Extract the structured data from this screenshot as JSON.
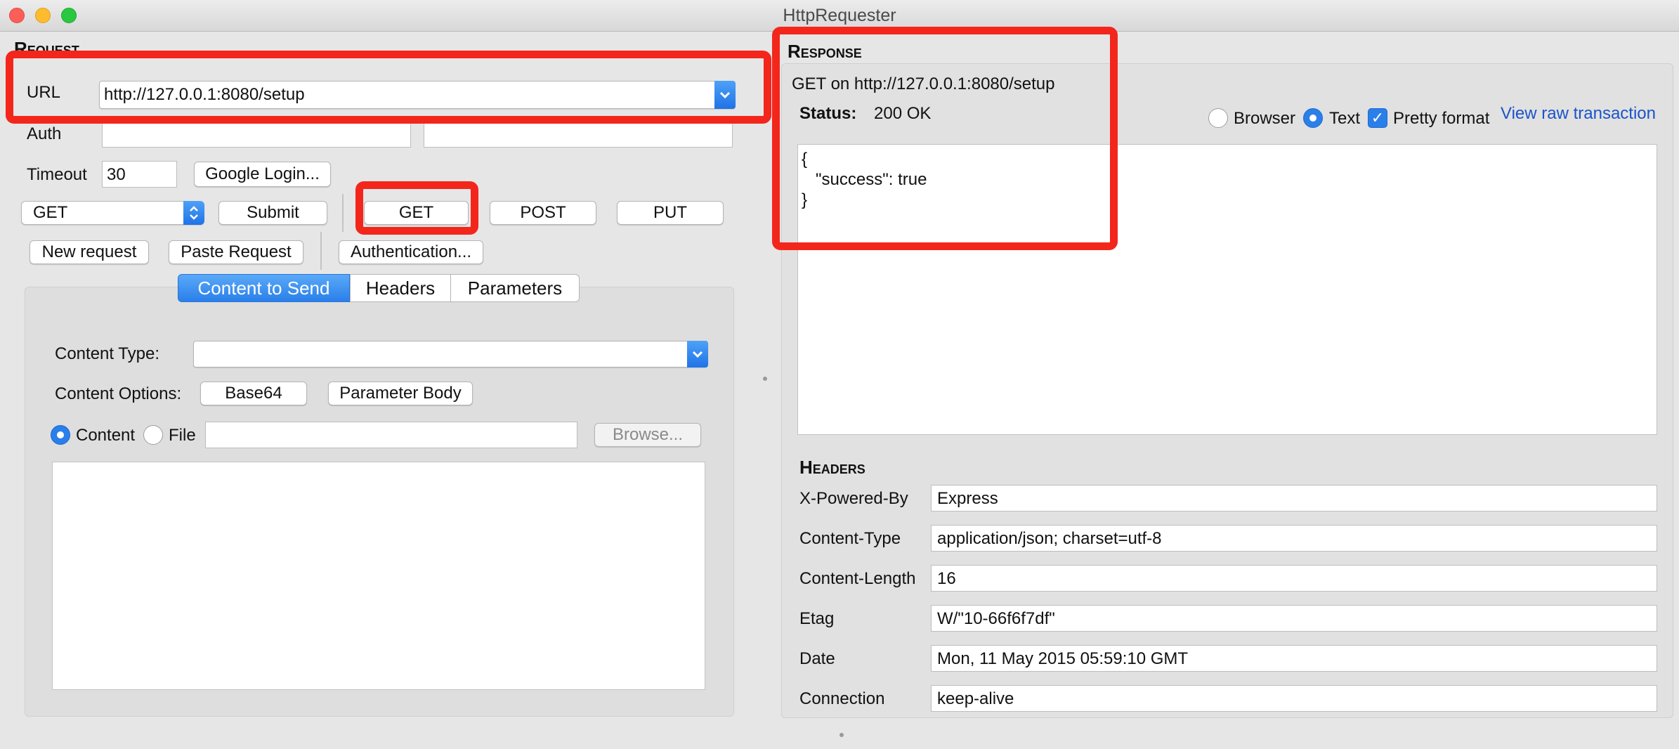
{
  "window": {
    "title": "HttpRequester"
  },
  "request": {
    "section_title": "Request",
    "url_label": "URL",
    "url_value": "http://127.0.0.1:8080/setup",
    "auth_label": "Auth",
    "auth_user": "",
    "auth_password": "",
    "timeout_label": "Timeout",
    "timeout_value": "30",
    "google_login": "Google Login...",
    "method_value": "GET",
    "submit": "Submit",
    "get": "GET",
    "post": "POST",
    "put": "PUT",
    "new_request": "New request",
    "paste_request": "Paste Request",
    "authentication": "Authentication...",
    "tabs": [
      {
        "label": "Content to Send",
        "active": true
      },
      {
        "label": "Headers",
        "active": false
      },
      {
        "label": "Parameters",
        "active": false
      }
    ],
    "content_type_label": "Content Type:",
    "content_type_value": "",
    "content_options_label": "Content Options:",
    "base64": "Base64",
    "parameter_body": "Parameter Body",
    "content_radio": "Content",
    "file_radio": "File",
    "file_path": "",
    "browse": "Browse...",
    "content_body": ""
  },
  "response": {
    "section_title": "Response",
    "summary": "GET on http://127.0.0.1:8080/setup",
    "status_label": "Status:",
    "status_value": "200 OK",
    "view_browser": "Browser",
    "view_text": "Text",
    "pretty_format": "Pretty format",
    "view_raw": "View raw transaction",
    "body": "{\n   \"success\": true\n}",
    "headers_title": "Headers",
    "headers": [
      {
        "name": "X-Powered-By",
        "value": "Express"
      },
      {
        "name": "Content-Type",
        "value": "application/json; charset=utf-8"
      },
      {
        "name": "Content-Length",
        "value": "16"
      },
      {
        "name": "Etag",
        "value": "W/\"10-66f6f7df\""
      },
      {
        "name": "Date",
        "value": "Mon, 11 May 2015 05:59:10 GMT"
      },
      {
        "name": "Connection",
        "value": "keep-alive"
      }
    ]
  },
  "colors": {
    "accent": "#2a7fe9",
    "annotation": "#f3261c",
    "link": "#1a53c9"
  }
}
